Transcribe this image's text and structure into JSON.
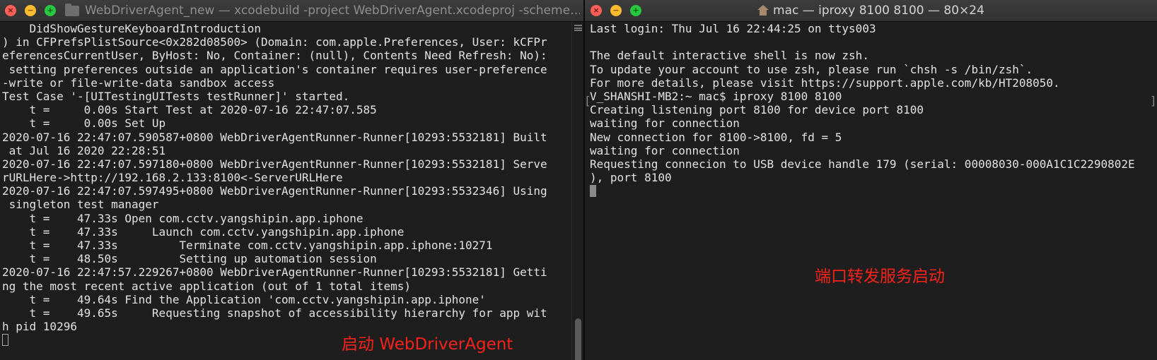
{
  "left_window": {
    "title": "WebDriverAgent_new — xcodebuild -project WebDriverAgent.xcodeproj -scheme…",
    "lines": [
      "    DidShowGestureKeyboardIntroduction",
      ") in CFPrefsPlistSource<0x282d08500> (Domain: com.apple.Preferences, User: kCFPr",
      "eferencesCurrentUser, ByHost: No, Container: (null), Contents Need Refresh: No):",
      " setting preferences outside an application's container requires user-preference",
      "-write or file-write-data sandbox access",
      "Test Case '-[UITestingUITests testRunner]' started.",
      "    t =     0.00s Start Test at 2020-07-16 22:47:07.585",
      "    t =     0.00s Set Up",
      "2020-07-16 22:47:07.590587+0800 WebDriverAgentRunner-Runner[10293:5532181] Built",
      " at Jul 16 2020 22:28:51",
      "2020-07-16 22:47:07.597180+0800 WebDriverAgentRunner-Runner[10293:5532181] Serve",
      "rURLHere->http://192.168.2.133:8100<-ServerURLHere",
      "2020-07-16 22:47:07.597495+0800 WebDriverAgentRunner-Runner[10293:5532346] Using",
      " singleton test manager",
      "    t =    47.33s Open com.cctv.yangshipin.app.iphone",
      "    t =    47.33s     Launch com.cctv.yangshipin.app.iphone",
      "    t =    47.33s         Terminate com.cctv.yangshipin.app.iphone:10271",
      "    t =    48.50s         Setting up automation session",
      "2020-07-16 22:47:57.229267+0800 WebDriverAgentRunner-Runner[10293:5532181] Getti",
      "ng the most recent active application (out of 1 total items)",
      "    t =    49.64s Find the Application 'com.cctv.yangshipin.app.iphone'",
      "    t =    49.65s     Requesting snapshot of accessibility hierarchy for app wit",
      "h pid 10296"
    ],
    "annotation": "启动 WebDriverAgent"
  },
  "right_window": {
    "title": "mac — iproxy 8100 8100 — 80×24",
    "lines": [
      "Last login: Thu Jul 16 22:44:25 on ttys003",
      "",
      "The default interactive shell is now zsh.",
      "To update your account to use zsh, please run `chsh -s /bin/zsh`.",
      "For more details, please visit https://support.apple.com/kb/HT208050.",
      "V_SHANSHI-MB2:~ mac$ iproxy 8100 8100",
      "Creating listening port 8100 for device port 8100",
      "waiting for connection",
      "New connection for 8100->8100, fd = 5",
      "waiting for connection",
      "Requesting connecion to USB device handle 179 (serial: 00008030-000A1C1C2290802E",
      "), port 8100"
    ],
    "annotation": "端口转发服务启动",
    "bracket_left": "[",
    "bracket_right": "]"
  },
  "icons": [
    "close-icon",
    "minimize-icon",
    "zoom-icon",
    "folder-icon",
    "home-icon"
  ],
  "colors": {
    "terminal_bg": "#1e1e1e",
    "terminal_text": "#e2e2e2",
    "annotation": "#f5231c",
    "close": "#fe5f57",
    "minimize": "#febc2e",
    "zoom": "#28c840"
  }
}
